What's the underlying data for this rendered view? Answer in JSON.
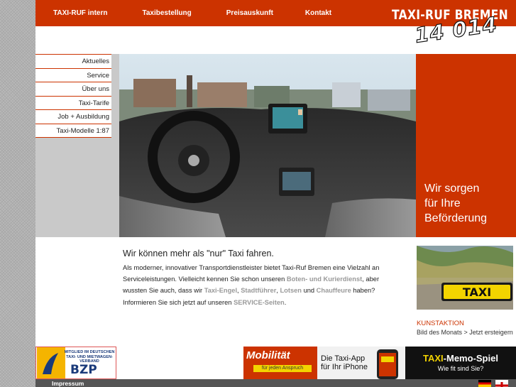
{
  "nav": {
    "items": [
      "TAXI-RUF intern",
      "Taxibestellung",
      "Preisauskunft",
      "Kontakt"
    ]
  },
  "brand": {
    "name": "TAXI-RUF BREMEN",
    "number": "14 014"
  },
  "sidenav": {
    "items": [
      "Aktuelles",
      "Service",
      "Über uns",
      "Taxi-Tarife",
      "Job + Ausbildung",
      "Taxi-Modelle 1:87"
    ]
  },
  "slogan": {
    "line1": "Wir sorgen",
    "line2": "für Ihre",
    "line3": "Beförderung"
  },
  "main": {
    "headline": "Wir können mehr als \"nur\" Taxi fahren.",
    "p1": "Als moderner, innovativer Transportdienstleister bietet Taxi-Ruf Bremen eine Vielzahl an Serviceleistungen. Vielleicht kennen Sie schon unseren ",
    "l1": "Boten- und Kurierdienst",
    "p2": ", aber wussten Sie auch, dass wir ",
    "l2": "Taxi-Engel",
    "p3": ", ",
    "l3": "Stadtführer",
    "p4": ", ",
    "l4": "Lotsen",
    "p5": " und ",
    "l5": "Chauffeure",
    "p6": " haben? Informieren Sie sich jetzt auf unseren ",
    "l6": "SERVICE-Seiten",
    "p7": "."
  },
  "kunst": {
    "title": "KUNSTAKTION",
    "text": "Bild des Monats > Jetzt ersteigern",
    "sign": "TAXI"
  },
  "footer": {
    "bzp_text": "MITGLIED IM DEUTSCHEN TAXI- UND MIETWAGEN- VERBAND",
    "bzp_logo": "BZP",
    "mob_title": "Mobilität",
    "mob_sub": "für jeden Anspruch",
    "app_l1": "Die Taxi-App",
    "app_l2": "für Ihr iPhone",
    "memo_a": "TAXI",
    "memo_b": "-Memo-Spiel",
    "memo_sub": "Wie fit sind Sie?",
    "impressum": "Impressum"
  },
  "colors": {
    "accent": "#cc3300",
    "grey": "#999999",
    "yellow": "#f3d400"
  }
}
